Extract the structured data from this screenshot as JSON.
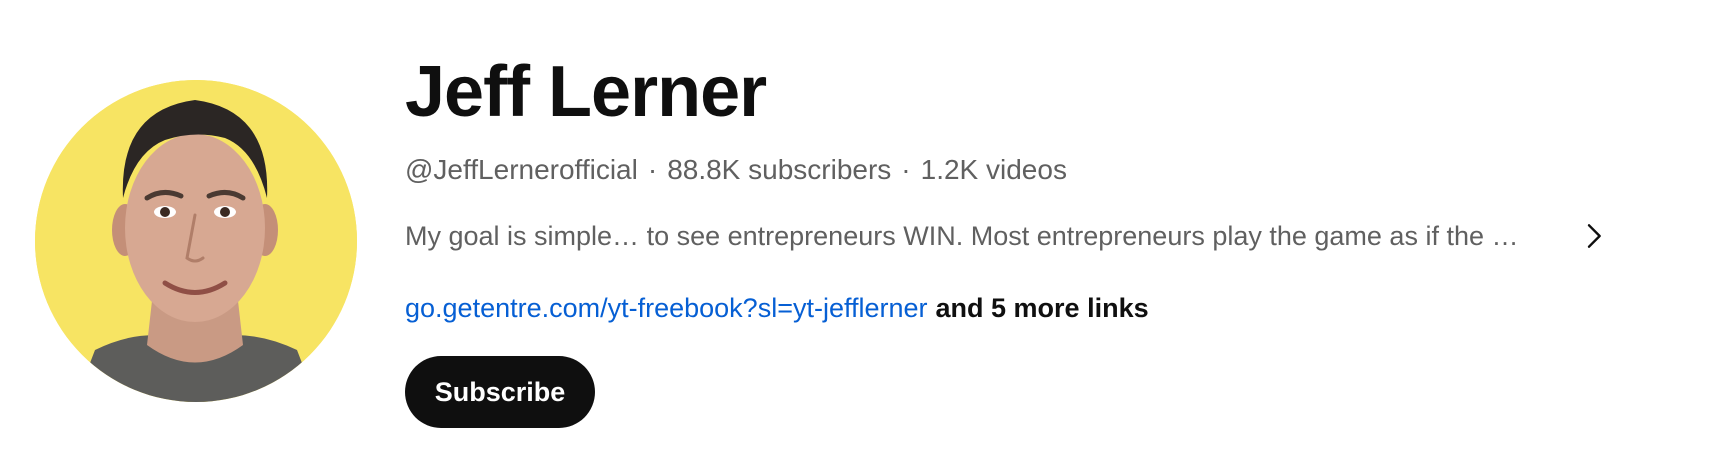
{
  "channel": {
    "name": "Jeff Lerner",
    "handle": "@JeffLernerofficial",
    "separator": "·",
    "subscribers": "88.8K subscribers",
    "videos": "1.2K videos",
    "description": "My goal is simple… to see entrepreneurs WIN. Most entrepreneurs play the game as if the …",
    "link_text": "go.getentre.com/yt-freebook?sl=yt-jefflerner",
    "more_links": "and 5 more links",
    "subscribe_label": "Subscribe"
  },
  "avatar": {
    "icon": "channel-avatar",
    "background_color": "#f7e463"
  },
  "colors": {
    "link": "#065fd4",
    "secondary_text": "#606060",
    "primary_text": "#0f0f0f",
    "button_bg": "#0f0f0f"
  },
  "icons": {
    "description_expand": "chevron-right-icon"
  }
}
